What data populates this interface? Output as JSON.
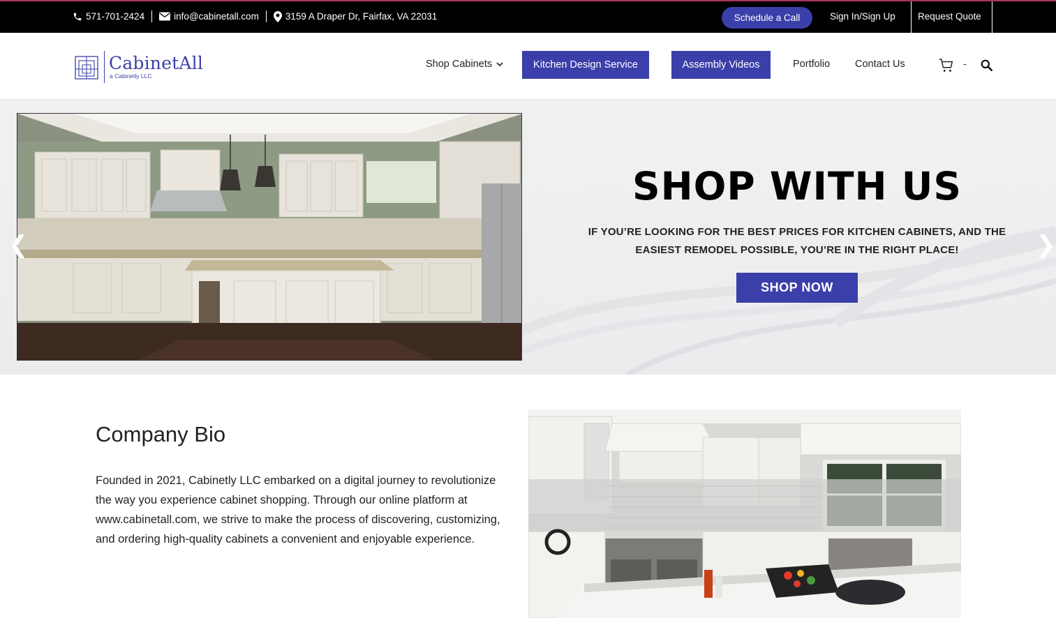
{
  "topbar": {
    "phone": "571-701-2424",
    "email": "info@cabinetall.com",
    "address": "3159 A Draper Dr, Fairfax, VA 22031",
    "schedule_label": "Schedule a Call",
    "signin_label": "Sign In/Sign Up",
    "quote_label": "Request Quote"
  },
  "logo": {
    "name": "CabinetAll",
    "sub": "a Cabinetly LLC"
  },
  "nav": {
    "shop": "Shop Cabinets",
    "kitchen_design": "Kitchen Design Service",
    "assembly": "Assembly Videos",
    "portfolio": "Portfolio",
    "contact": "Contact Us",
    "cart_count": "-"
  },
  "hero": {
    "title": "SHOP WITH US",
    "subtitle": "IF YOU’RE LOOKING FOR THE BEST PRICES FOR KITCHEN CABINETS, AND THE EASIEST REMODEL POSSIBLE, YOU’RE IN THE RIGHT PLACE!",
    "button": "SHOP NOW",
    "prev": "❮",
    "next": "❯"
  },
  "bio": {
    "title": "Company Bio",
    "text": "Founded in 2021, Cabinetly LLC embarked on a digital journey to revolutionize the way you experience cabinet shopping. Through our online platform at www.cabinetall.com, we strive to make the process of discovering, customizing, and ordering high-quality cabinets a convenient and enjoyable experience."
  },
  "colors": {
    "brand": "#3a3fa9",
    "topbar": "#000000",
    "hero_bg": "#efeff1"
  }
}
